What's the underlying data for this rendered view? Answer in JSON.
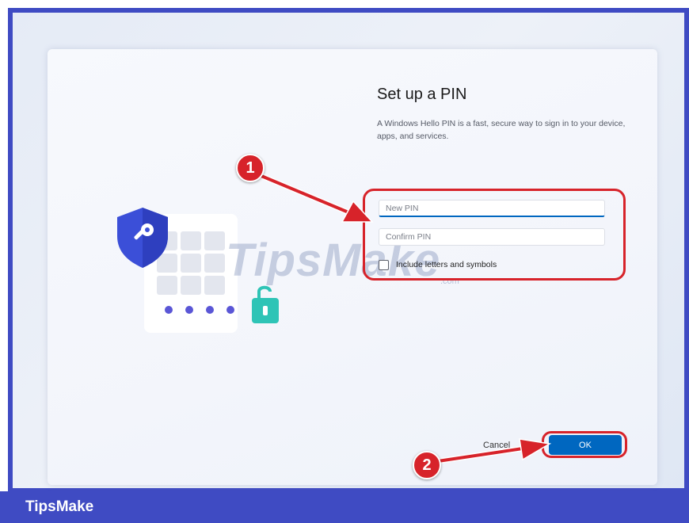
{
  "dialog": {
    "title": "Set up a PIN",
    "description": "A Windows Hello PIN is a fast, secure way to sign in to your device, apps, and services.",
    "new_pin_placeholder": "New PIN",
    "confirm_pin_placeholder": "Confirm PIN",
    "include_label": "Include letters and symbols",
    "include_checked": false,
    "cancel_label": "Cancel",
    "ok_label": "OK"
  },
  "annotations": {
    "step1": "1",
    "step2": "2"
  },
  "watermark": {
    "text": "TipsMake",
    "sub": ".com"
  },
  "footer": {
    "brand": "TipsMake"
  },
  "colors": {
    "frame": "#3f4bc3",
    "accent": "#0067c0",
    "annotation_red": "#d7232a",
    "shield_blue": "#3b4fd8",
    "lock_teal": "#2ec4b6",
    "dot_purple": "#5a56d6"
  },
  "icons": {
    "shield": "shield-key-icon",
    "keypad": "keypad-icon",
    "lock": "unlocked-padlock-icon"
  }
}
